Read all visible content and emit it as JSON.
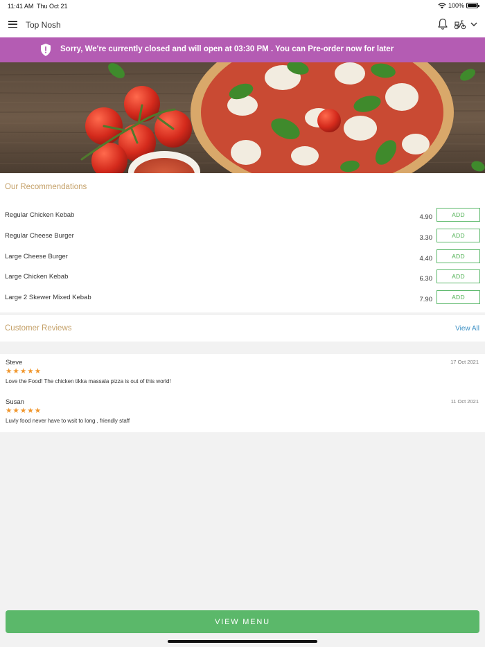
{
  "status_bar": {
    "time": "11:41 AM",
    "date": "Thu Oct 21",
    "battery": "100%"
  },
  "app_bar": {
    "title": "Top Nosh"
  },
  "banner": {
    "text": "Sorry, We're currently closed and will open at 03:30 PM . You can Pre-order now for later",
    "color": "#b45cb3"
  },
  "recommendations": {
    "title": "Our Recommendations",
    "add_label": "ADD",
    "items": [
      {
        "name": "Regular Chicken Kebab",
        "price": "4.90"
      },
      {
        "name": "Regular Cheese Burger",
        "price": "3.30"
      },
      {
        "name": "Large Cheese Burger",
        "price": "4.40"
      },
      {
        "name": "Large Chicken Kebab",
        "price": "6.30"
      },
      {
        "name": "Large 2 Skewer Mixed Kebab",
        "price": "7.90"
      }
    ]
  },
  "reviews": {
    "title": "Customer Reviews",
    "view_all": "View All",
    "items": [
      {
        "name": "Steve",
        "date": "17 Oct 2021",
        "rating": 5,
        "text": "Love the Food! The chicken tikka massala pizza is out of this world!"
      },
      {
        "name": "Susan",
        "date": "11 Oct 2021",
        "rating": 5,
        "text": "Luvly food never have to wsit to long , friendly staff"
      }
    ]
  },
  "footer": {
    "view_menu": "VIEW MENU"
  },
  "colors": {
    "accent_green": "#5bb86a",
    "heading_gold": "#c4a068",
    "link_blue": "#3a8fc4",
    "star_orange": "#f0952a"
  }
}
